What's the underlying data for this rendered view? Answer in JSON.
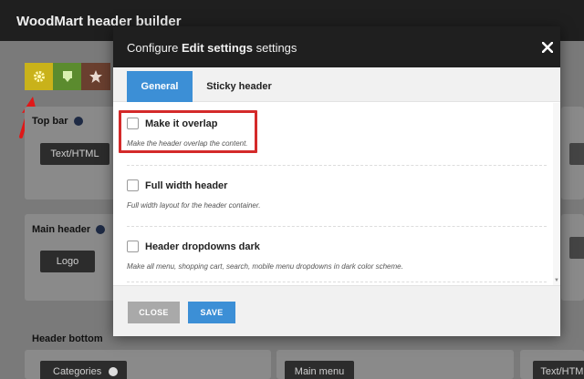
{
  "app": {
    "title": "WoodMart header builder"
  },
  "background": {
    "sections": {
      "top_bar": "Top bar",
      "main_header": "Main header",
      "header_bottom": "Header bottom"
    },
    "buttons": {
      "text_html_left": "Text/HTML",
      "logo": "Logo",
      "categories": "Categories",
      "main_menu": "Main menu",
      "text_html_right": "Text/HTML"
    },
    "toolbar_icons": [
      "gear-icon",
      "download-icon",
      "star-icon"
    ],
    "colors": {
      "gear": "#c9b21a",
      "download": "#5b8b2e",
      "star": "#6a3f2f"
    }
  },
  "modal": {
    "title_prefix": "Configure ",
    "title_bold": "Edit settings",
    "title_suffix": " settings",
    "close_icon": "close-icon",
    "tabs": [
      {
        "label": "General",
        "active": true
      },
      {
        "label": "Sticky header",
        "active": false
      }
    ],
    "options": [
      {
        "label": "Make it overlap",
        "description": "Make the header overlap the content.",
        "checked": false
      },
      {
        "label": "Full width header",
        "description": "Full width layout for the header container.",
        "checked": false
      },
      {
        "label": "Header dropdowns dark",
        "description": "Make all menu, shopping cart, search, mobile menu dropdowns in dark color scheme.",
        "checked": false
      }
    ],
    "footer": {
      "close_label": "CLOSE",
      "save_label": "SAVE"
    },
    "colors": {
      "accent": "#3c8fd6",
      "highlight": "#d42a2a",
      "close_btn": "#a9a9a9"
    }
  }
}
